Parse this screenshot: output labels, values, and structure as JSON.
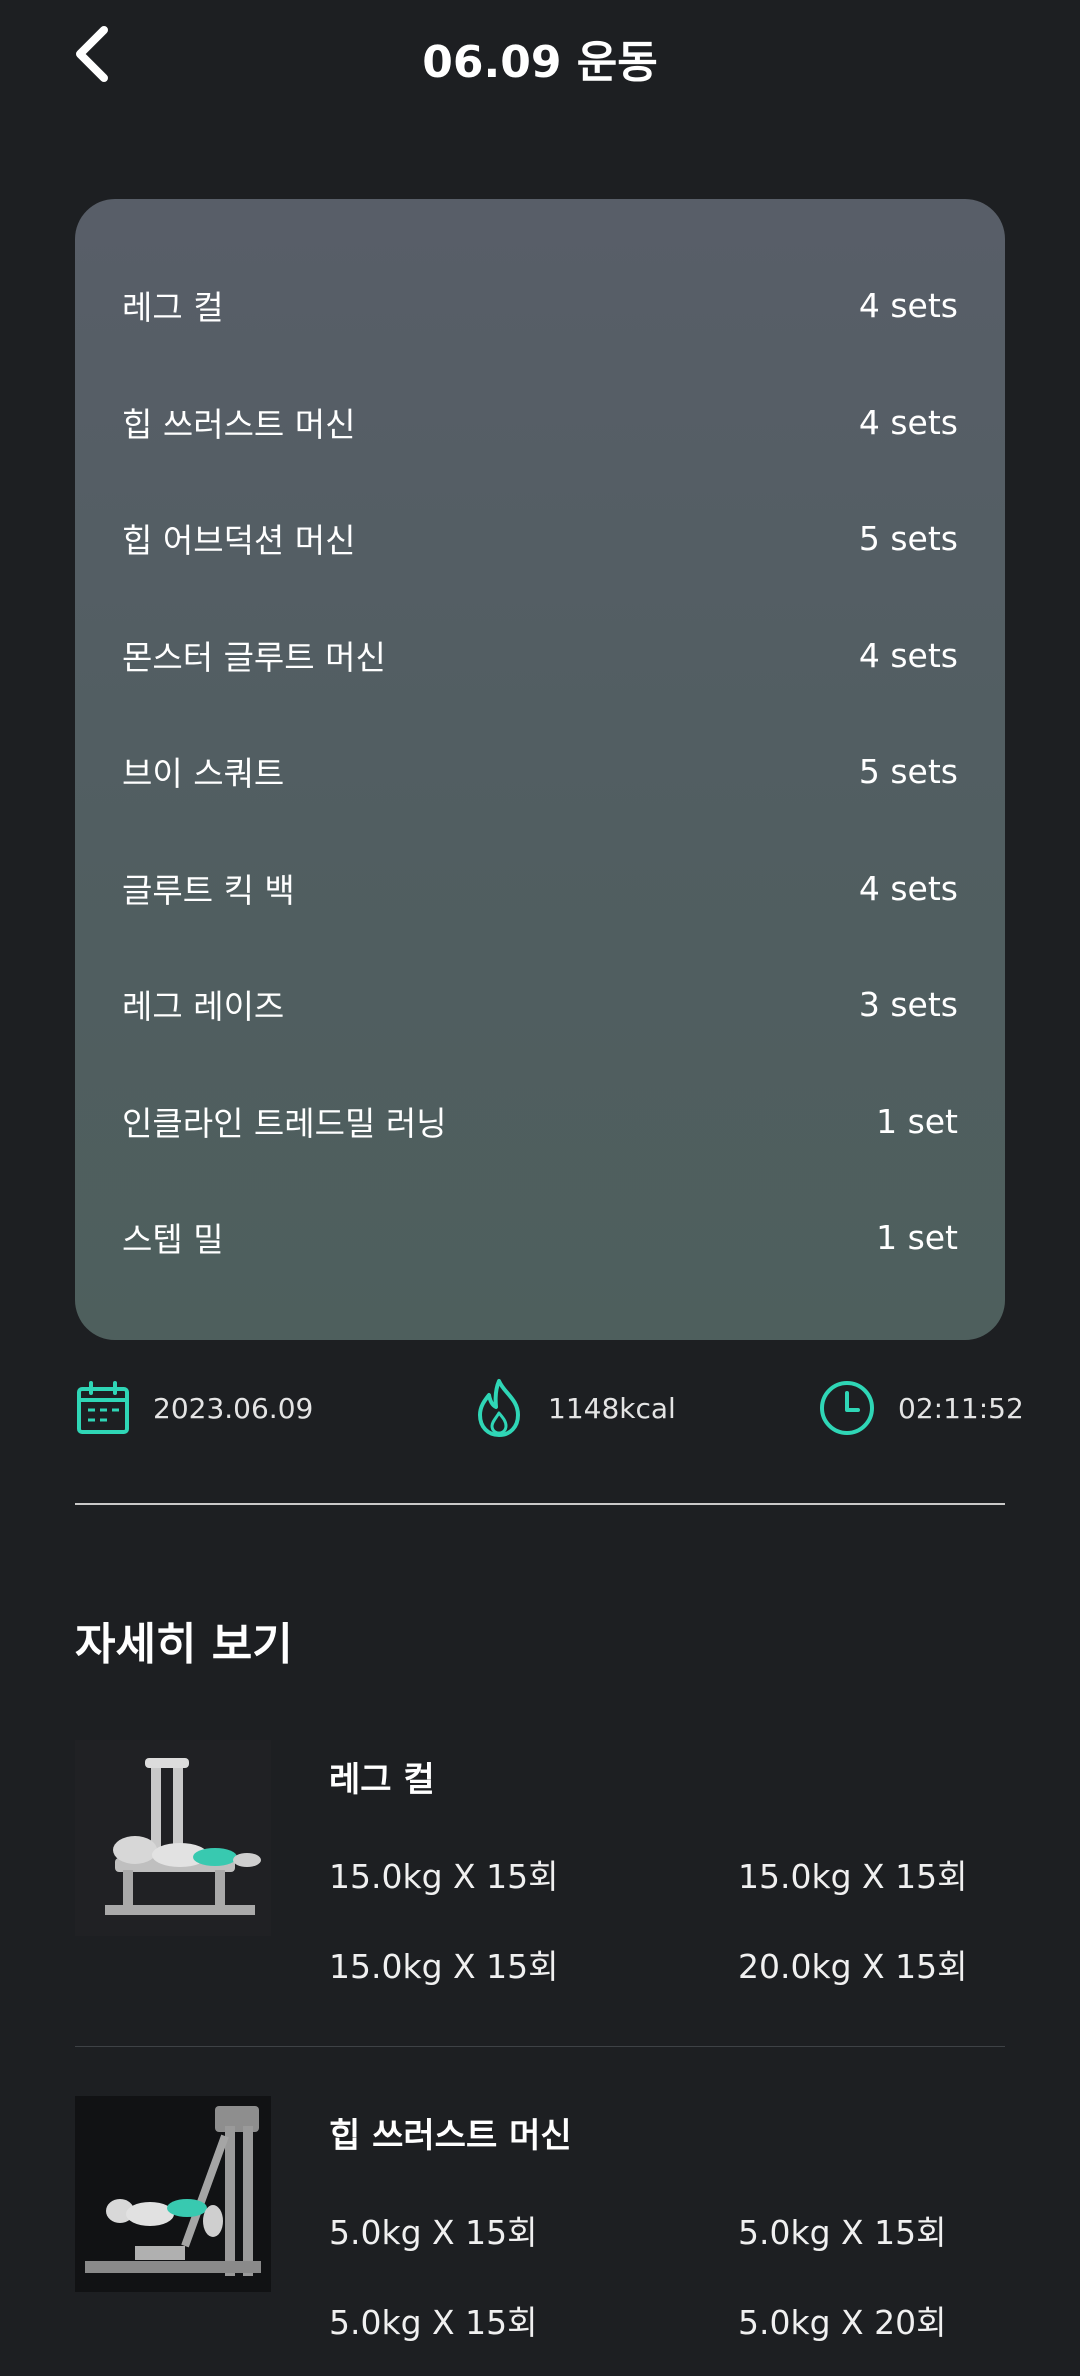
{
  "header": {
    "title": "06.09 운동"
  },
  "exercises": [
    {
      "name": "레그 컬",
      "sets": "4 sets"
    },
    {
      "name": "힙 쓰러스트 머신",
      "sets": "4 sets"
    },
    {
      "name": "힙 어브덕션 머신",
      "sets": "5 sets"
    },
    {
      "name": "몬스터 글루트 머신",
      "sets": "4 sets"
    },
    {
      "name": "브이 스쿼트",
      "sets": "5 sets"
    },
    {
      "name": "글루트 킥 백",
      "sets": "4 sets"
    },
    {
      "name": "레그 레이즈",
      "sets": "3 sets"
    },
    {
      "name": "인클라인 트레드밀 러닝",
      "sets": "1 set"
    },
    {
      "name": "스텝 밀",
      "sets": "1 set"
    }
  ],
  "stats": {
    "date": "2023.06.09",
    "calories": "1148kcal",
    "duration": "02:11:52"
  },
  "section_title": "자세히 보기",
  "details": [
    {
      "name": "레그 컬",
      "sets": [
        "15.0kg X 15회",
        "15.0kg X 15회",
        "15.0kg X 15회",
        "20.0kg X 15회"
      ]
    },
    {
      "name": "힙 쓰러스트 머신",
      "sets": [
        "5.0kg X 15회",
        "5.0kg X 15회",
        "5.0kg X 15회",
        "5.0kg X 20회"
      ]
    }
  ],
  "colors": {
    "background": "#1d1f22",
    "accent": "#2fd6b6"
  },
  "icons": {
    "back": "chevron-left-icon",
    "date": "calendar-icon",
    "calories": "flame-icon",
    "duration": "clock-icon"
  }
}
